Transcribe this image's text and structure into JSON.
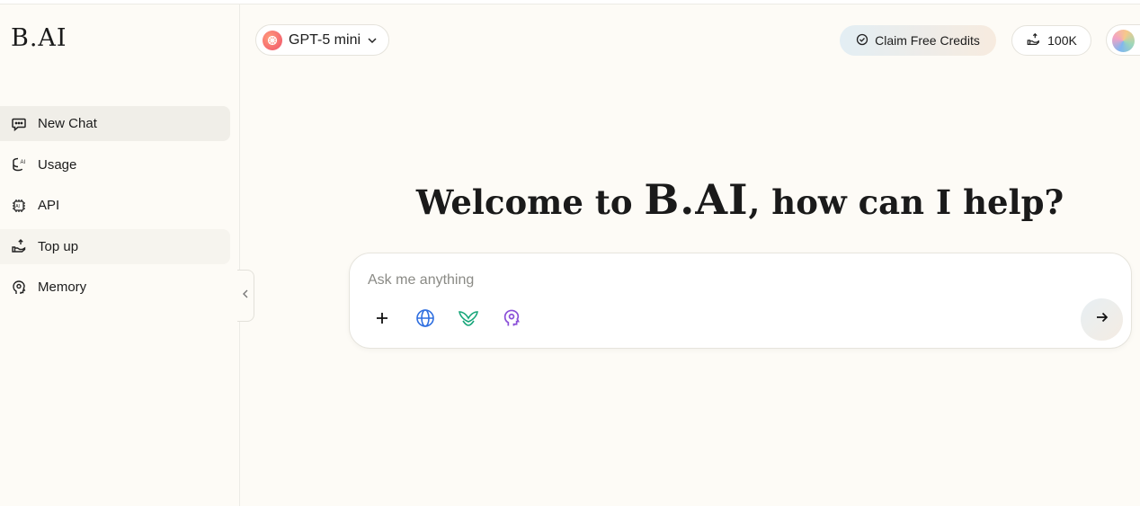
{
  "brand": {
    "logo": "B.AI"
  },
  "sidebar": {
    "items": [
      {
        "label": "New Chat",
        "icon": "chat-bubble-icon"
      },
      {
        "label": "Usage",
        "icon": "usage-icon"
      },
      {
        "label": "API",
        "icon": "chip-icon"
      },
      {
        "label": "Top up",
        "icon": "top-up-icon"
      },
      {
        "label": "Memory",
        "icon": "memory-head-icon"
      }
    ]
  },
  "header": {
    "model": "GPT-5 mini",
    "claim_label": "Claim Free Credits",
    "balance": "100K"
  },
  "main": {
    "welcome_prefix": "Welcome to",
    "welcome_brand": "B.AI",
    "welcome_suffix": ", how can I help?",
    "placeholder": "Ask me anything"
  },
  "colors": {
    "accent_blue": "#2f6fe0",
    "accent_green": "#17a67a",
    "accent_purple": "#8a4fd8"
  }
}
